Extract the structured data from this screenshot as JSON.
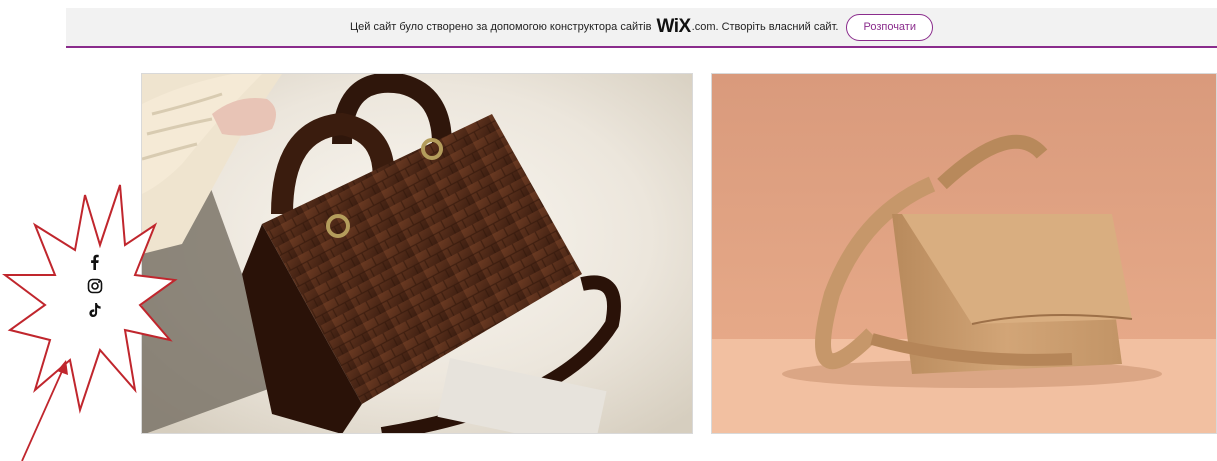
{
  "banner": {
    "text_before_logo": "Цей сайт було створено за допомогою конструктора сайтів",
    "logo": "WiX",
    "logo_suffix": ".com.",
    "text_after_logo": "Створіть власний сайт.",
    "cta_label": "Розпочати",
    "accent_color": "#8a2c8c"
  },
  "gallery": {
    "images": [
      {
        "subject": "brown croc-embossed top-handle handbag"
      },
      {
        "subject": "tan leather crossbody bag"
      }
    ]
  },
  "social": {
    "icons": [
      "facebook-icon",
      "instagram-icon",
      "tiktok-icon"
    ]
  },
  "annotation": {
    "shape": "red outlined starburst",
    "arrow_color": "#c0262d"
  }
}
